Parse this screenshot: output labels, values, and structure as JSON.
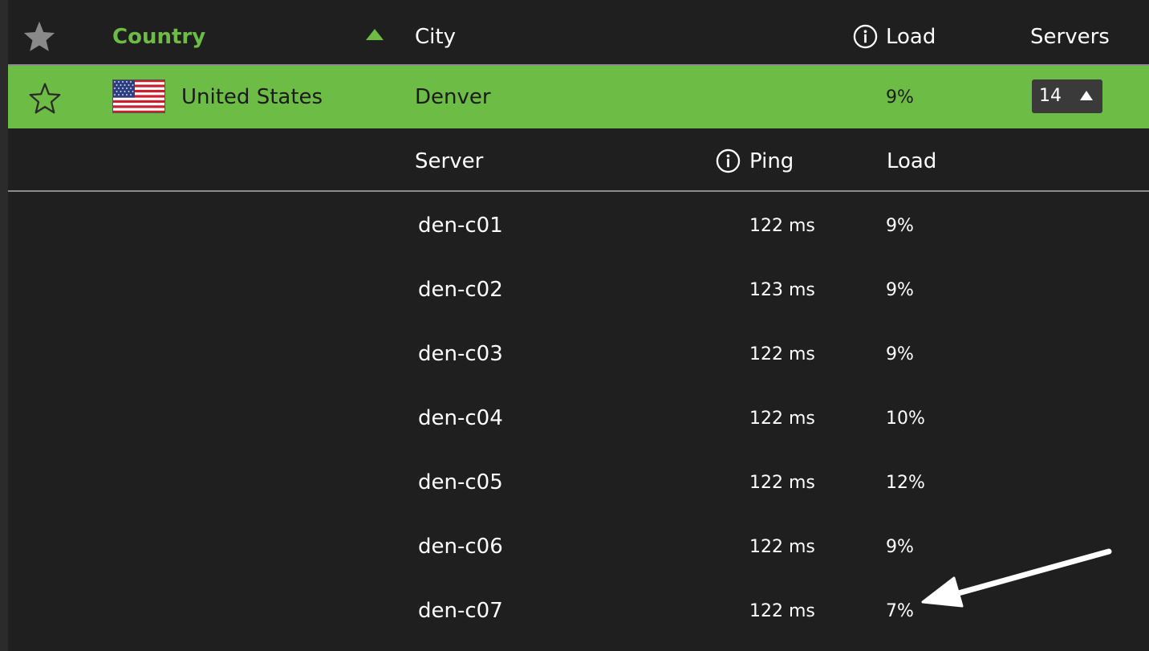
{
  "header": {
    "country_label": "Country",
    "city_label": "City",
    "load_label": "Load",
    "servers_label": "Servers",
    "icons": [
      "star-icon",
      "sort-up-icon",
      "info-icon"
    ],
    "accent_color": "#6dbc45"
  },
  "selected_row": {
    "country": "United States",
    "city": "Denver",
    "load": "9%",
    "server_count": "14"
  },
  "sub_header": {
    "server_label": "Server",
    "ping_label": "Ping",
    "load_label": "Load"
  },
  "servers": [
    {
      "name": "den-c01",
      "ping": "122 ms",
      "load": "9%"
    },
    {
      "name": "den-c02",
      "ping": "123 ms",
      "load": "9%"
    },
    {
      "name": "den-c03",
      "ping": "122 ms",
      "load": "9%"
    },
    {
      "name": "den-c04",
      "ping": "122 ms",
      "load": "10%"
    },
    {
      "name": "den-c05",
      "ping": "122 ms",
      "load": "12%"
    },
    {
      "name": "den-c06",
      "ping": "122 ms",
      "load": "9%"
    },
    {
      "name": "den-c07",
      "ping": "122 ms",
      "load": "7%"
    }
  ]
}
